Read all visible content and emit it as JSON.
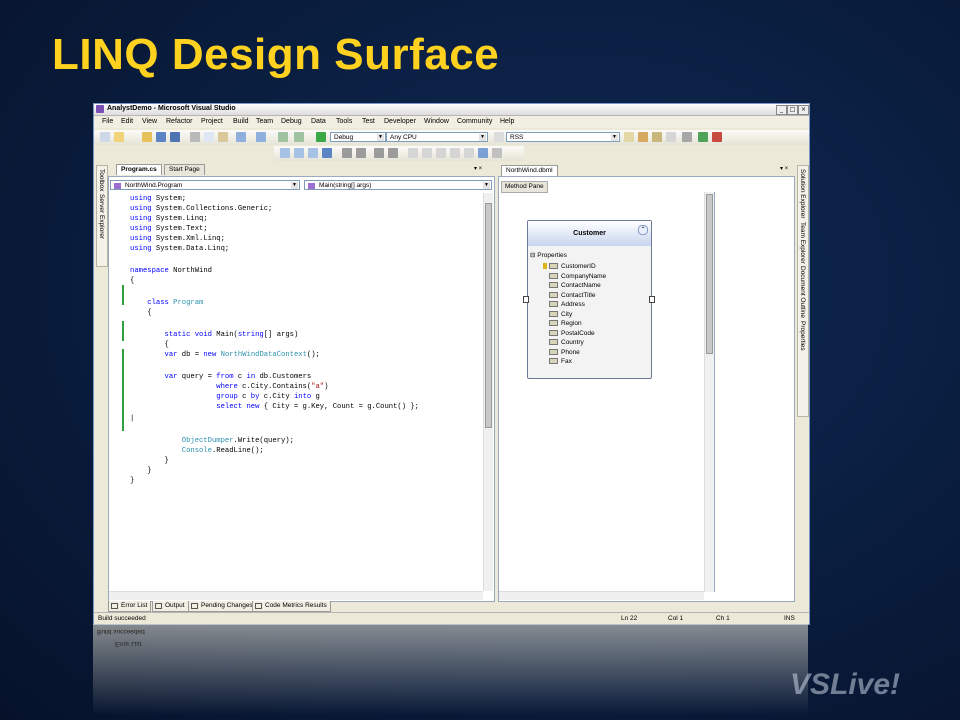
{
  "slide": {
    "title": "LINQ Design Surface",
    "logo": "VSLive!"
  },
  "window": {
    "title": "AnalystDemo - Microsoft Visual Studio",
    "min": "_",
    "max": "□",
    "close": "×"
  },
  "menu": [
    "File",
    "Edit",
    "View",
    "Refactor",
    "Project",
    "Build",
    "Team",
    "Debug",
    "Data",
    "Tools",
    "Test",
    "Developer",
    "Window",
    "Community",
    "Help"
  ],
  "toolbar": {
    "config": "Debug",
    "platform": "Any CPU",
    "find": "RSS"
  },
  "side_tabs": {
    "left": [
      "Toolbox",
      "Server Explorer"
    ],
    "right": [
      "Solution Explorer",
      "Team Explorer",
      "Document Outline",
      "Properties"
    ]
  },
  "editor": {
    "tabs": [
      "Program.cs",
      "Start Page"
    ],
    "type_combo": "NorthWind.Program",
    "member_combo": "Main(string[] args)"
  },
  "code_lines": [
    "using System;",
    "using System.Collections.Generic;",
    "using System.Linq;",
    "using System.Text;",
    "using System.Xml.Linq;",
    "using System.Data.Linq;",
    "",
    "namespace NorthWind",
    "{",
    "",
    "    class Program",
    "    {",
    "",
    "        static void Main(string[] args)",
    "        {",
    "        var db = new NorthWindDataContext();",
    "",
    "        var query = from c in db.Customers",
    "                    where c.City.Contains(\"a\")",
    "                    group c by c.City into g",
    "                    select new { City = g.Key, Count = g.Count() };",
    "",
    "",
    "            ObjectDumper.Write(query);",
    "            Console.ReadLine();",
    "        }",
    "    }",
    "}"
  ],
  "designer": {
    "tab": "NorthWind.dbml",
    "method_pane": "Method Pane",
    "entity": {
      "name": "Customer",
      "section": "Properties",
      "properties": [
        "CustomerID",
        "CompanyName",
        "ContactName",
        "ContactTitle",
        "Address",
        "City",
        "Region",
        "PostalCode",
        "Country",
        "Phone",
        "Fax"
      ]
    }
  },
  "bottom_tabs": [
    "Error List",
    "Output",
    "Pending Changes",
    "Code Metrics Results"
  ],
  "status": {
    "message": "Build succeeded",
    "line": "Ln 22",
    "col": "Col 1",
    "ch": "Ch 1",
    "mode": "INS"
  },
  "colors": {
    "title": "#ffd21f",
    "keyword": "#0000ff",
    "type": "#2b91af",
    "string": "#a31515"
  }
}
